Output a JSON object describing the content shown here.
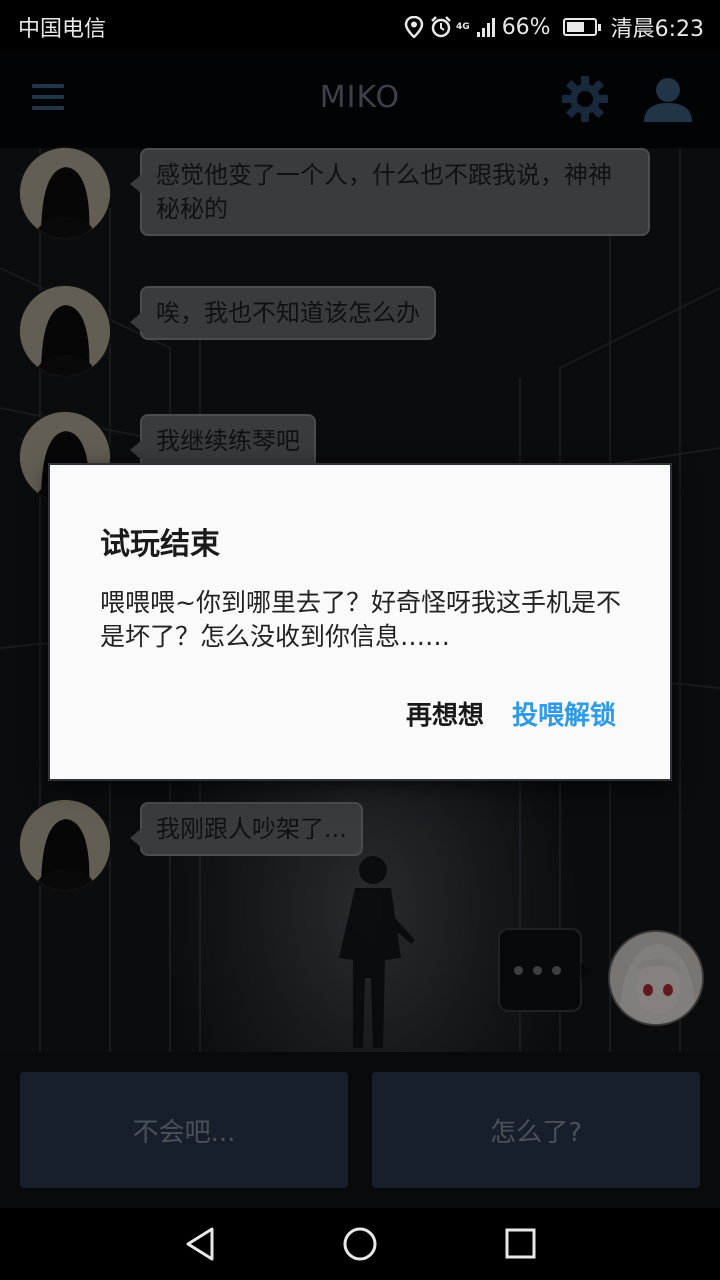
{
  "status_bar": {
    "carrier": "中国电信",
    "network": "4G",
    "battery": "66%",
    "battery_level": 0.66,
    "time": "清晨6:23"
  },
  "app_bar": {
    "title": "MIKO",
    "menu_icon": "menu-icon",
    "settings_icon": "gear-icon",
    "profile_icon": "user-icon"
  },
  "messages": [
    {
      "sender": "contact",
      "text": "感觉他变了一个人，什么也不跟我说，神神秘秘的"
    },
    {
      "sender": "contact",
      "text": "唉，我也不知道该怎么办"
    },
    {
      "sender": "contact",
      "text": "我继续练琴吧"
    },
    {
      "sender": "contact",
      "text": "我刚跟人吵架了..."
    }
  ],
  "typing_indicator": "• • •",
  "reply_options": [
    {
      "label": "不会吧..."
    },
    {
      "label": "怎么了?"
    }
  ],
  "dialog": {
    "title": "试玩结束",
    "message": "喂喂喂~你到哪里去了？好奇怪呀我这手机是不是坏了？怎么没收到你信息……",
    "cancel_label": "再想想",
    "confirm_label": "投喂解锁",
    "confirm_color": "#2f9ae6"
  },
  "nav_bar": {
    "back_icon": "back-icon",
    "home_icon": "home-icon",
    "recents_icon": "recents-icon"
  },
  "colors": {
    "app_title": "#6d7585",
    "accent": "#3f5f84",
    "option_button": "#2b3952"
  }
}
